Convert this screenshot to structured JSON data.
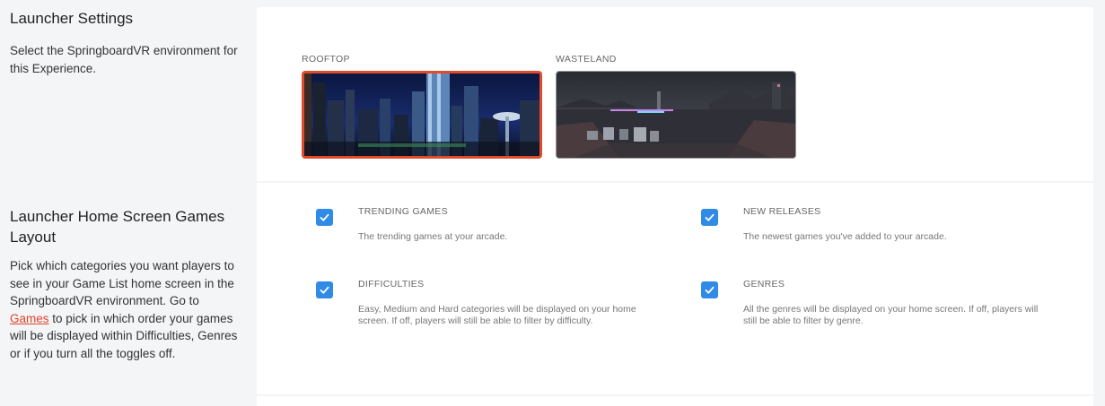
{
  "launcher_settings": {
    "heading": "Launcher Settings",
    "description": "Select the SpringboardVR environment for this Experience."
  },
  "environments": [
    {
      "label": "ROOFTOP",
      "selected": true,
      "scene": "city-skyline-night"
    },
    {
      "label": "WASTELAND",
      "selected": false,
      "scene": "dark-wasteland"
    }
  ],
  "layout_settings": {
    "heading": "Launcher Home Screen Games Layout",
    "description_before_link": "Pick which categories you want players to see in your Game List home screen in the SpringboardVR environment. Go to ",
    "link_text": "Games",
    "description_after_link": " to pick in which order your games will be displayed within Difficulties, Genres or if you turn all the toggles off."
  },
  "categories": [
    {
      "title": "TRENDING GAMES",
      "description": "The trending games at your arcade.",
      "checked": true
    },
    {
      "title": "NEW RELEASES",
      "description": "The newest games you've added to your arcade.",
      "checked": true
    },
    {
      "title": "DIFFICULTIES",
      "description": "Easy, Medium and Hard categories will be displayed on your home screen. If off, players will still be able to filter by difficulty.",
      "checked": true
    },
    {
      "title": "GENRES",
      "description": "All the genres will be displayed on your home screen. If off, players will still be able to filter by genre.",
      "checked": true
    }
  ],
  "colors": {
    "accent_selected": "#e24a2c",
    "checkbox": "#2f8be6",
    "link": "#e0442b"
  }
}
